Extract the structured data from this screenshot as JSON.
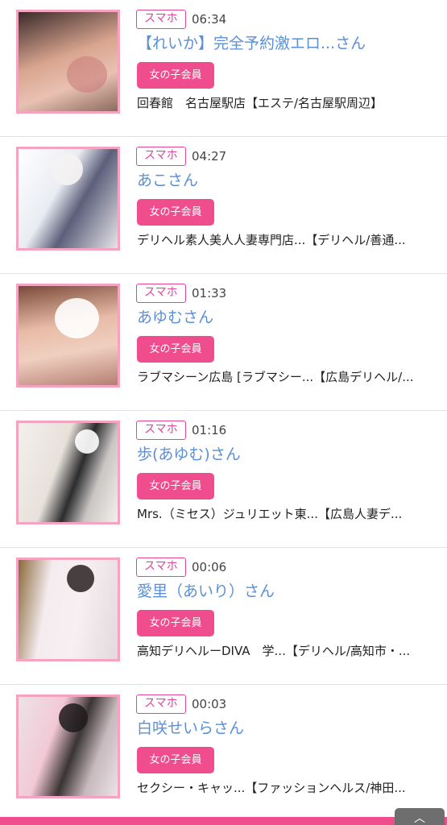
{
  "items": [
    {
      "badge": "スマホ",
      "time": "06:34",
      "name": "【れいか】完全予約激エロ...さん",
      "member": "女の子会員",
      "shop": "回春館　名古屋駅店【エステ/名古屋駅周辺】"
    },
    {
      "badge": "スマホ",
      "time": "04:27",
      "name": "あこさん",
      "member": "女の子会員",
      "shop": "デリヘル素人美人人妻専門店...【デリヘル/善通..."
    },
    {
      "badge": "スマホ",
      "time": "01:33",
      "name": "あゆむさん",
      "member": "女の子会員",
      "shop": "ラブマシーン広島 [ラブマシー...【広島デリヘル/..."
    },
    {
      "badge": "スマホ",
      "time": "01:16",
      "name": "歩(あゆむ)さん",
      "member": "女の子会員",
      "shop": "Mrs.（ミセス）ジュリエット東...【広島人妻デ..."
    },
    {
      "badge": "スマホ",
      "time": "00:06",
      "name": "愛里（あいり）さん",
      "member": "女の子会員",
      "shop": "高知デリヘルーDIVA　学...【デリヘル/高知市・..."
    },
    {
      "badge": "スマホ",
      "time": "00:03",
      "name": "白咲せいらさん",
      "member": "女の子会員",
      "shop": "セクシー・キャッ...【ファッションヘルス/神田..."
    }
  ],
  "to_top_icon": "chevron-up-icon",
  "colors": {
    "accent": "#f04d8f",
    "name": "#5b8fd6",
    "thumb_border": "#f4a3c0",
    "badge": "#e0459a"
  }
}
